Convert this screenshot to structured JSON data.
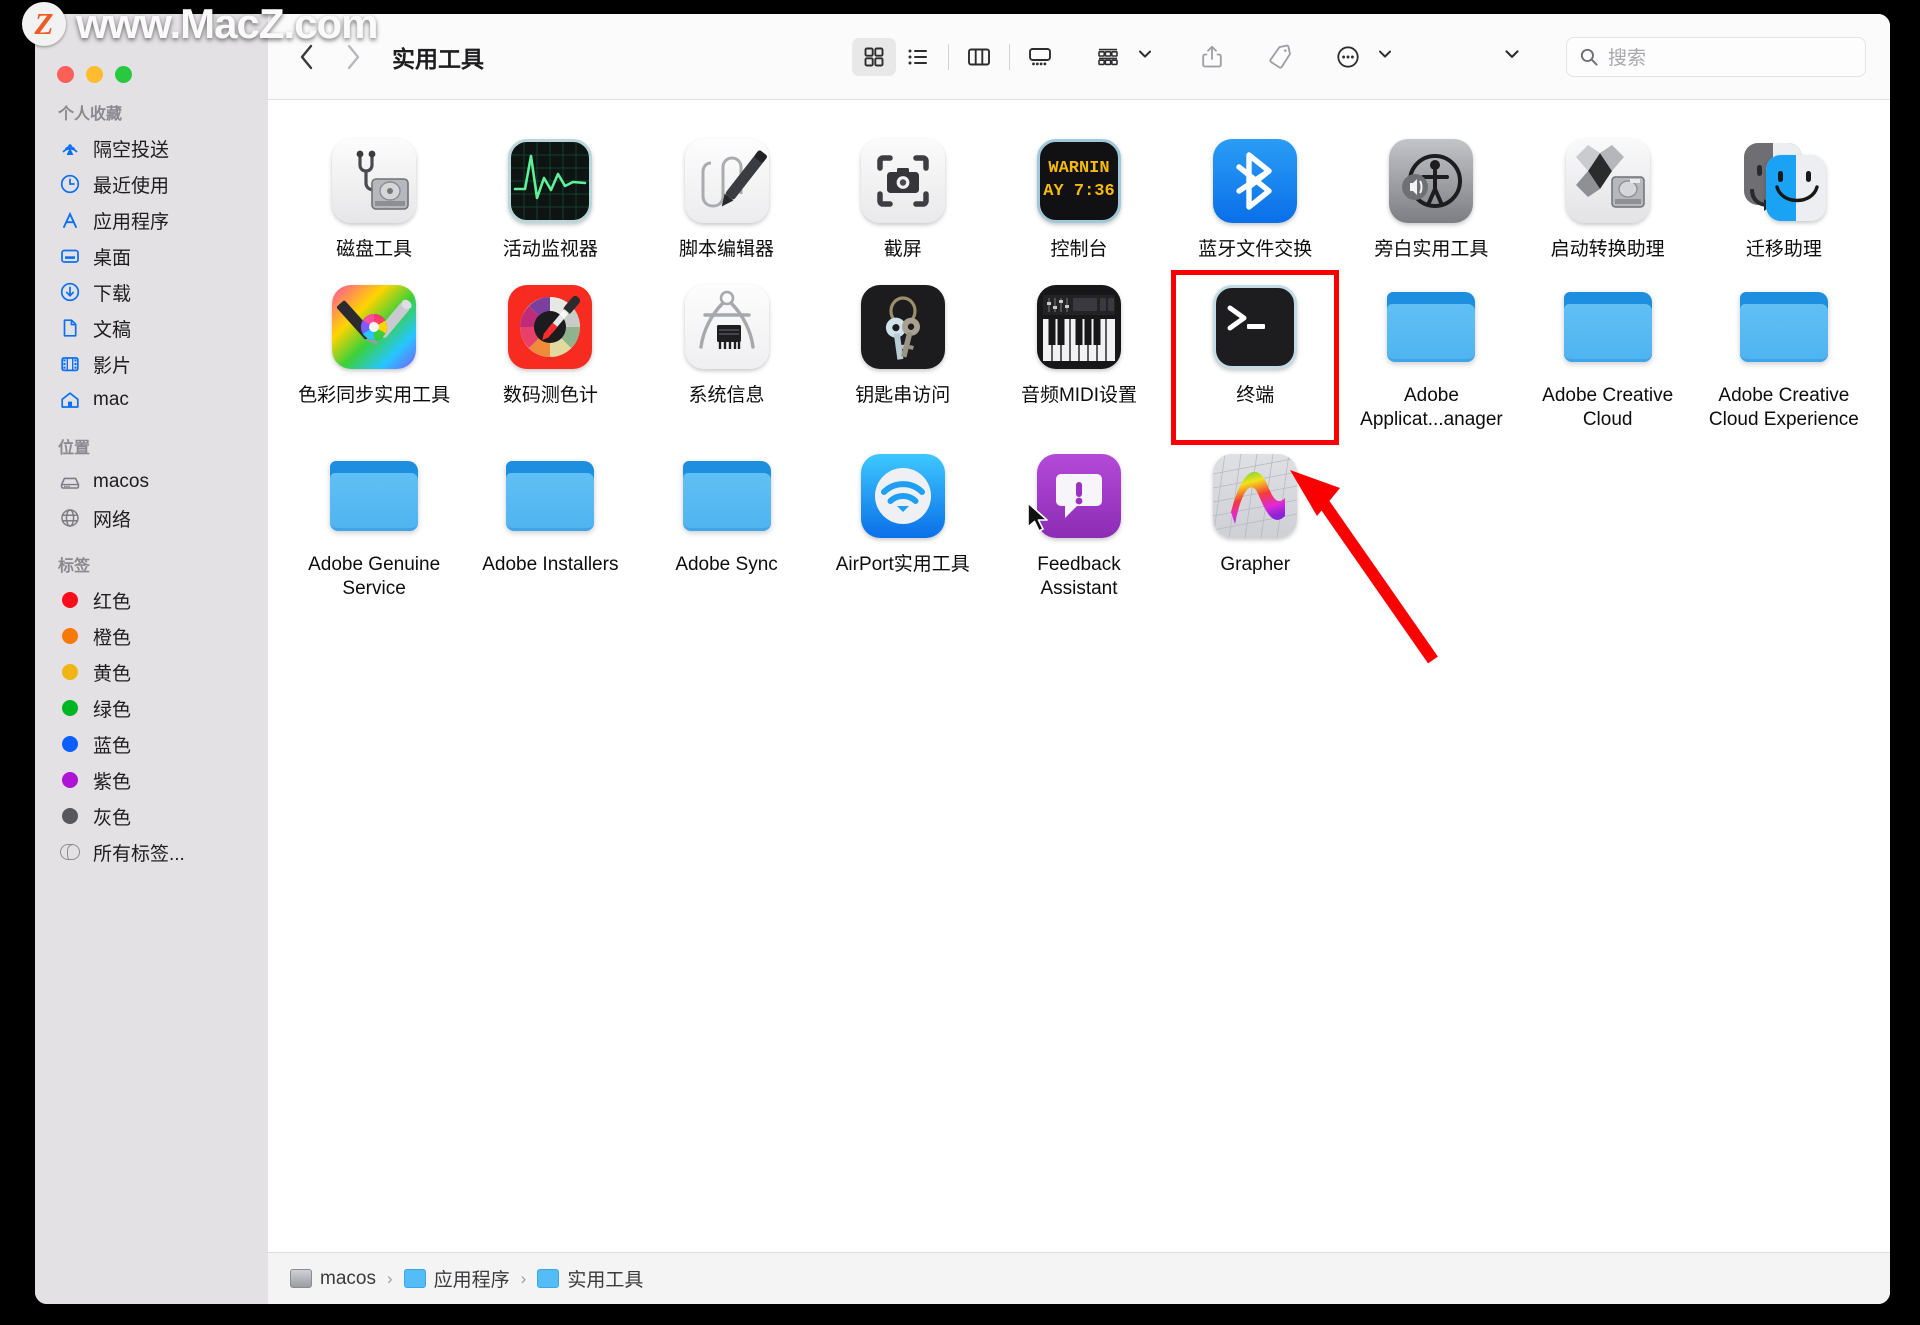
{
  "watermark": {
    "badge": "Z",
    "text": "www.MacZ.com"
  },
  "window": {
    "title": "实用工具",
    "traffic_lights": {
      "close": "close-red",
      "minimize": "minimize-yellow",
      "zoom": "zoom-green"
    }
  },
  "toolbar": {
    "back_label": "‹",
    "forward_label": "›",
    "view_icon_grid": "icon-view",
    "view_list": "list-view",
    "view_column": "column-view",
    "view_gallery": "gallery-view",
    "group_label": "group-by",
    "share_label": "share",
    "tag_label": "tag",
    "more_label": "more-actions"
  },
  "search": {
    "placeholder": "搜索",
    "value": ""
  },
  "sidebar": {
    "sections": [
      {
        "title": "个人收藏",
        "items": [
          {
            "label": "隔空投送",
            "icon": "airdrop-icon"
          },
          {
            "label": "最近使用",
            "icon": "clock-icon"
          },
          {
            "label": "应用程序",
            "icon": "applications-icon"
          },
          {
            "label": "桌面",
            "icon": "desktop-icon"
          },
          {
            "label": "下载",
            "icon": "downloads-icon"
          },
          {
            "label": "文稿",
            "icon": "documents-icon"
          },
          {
            "label": "影片",
            "icon": "movies-icon"
          },
          {
            "label": "mac",
            "icon": "home-icon"
          }
        ]
      },
      {
        "title": "位置",
        "items": [
          {
            "label": "macos",
            "icon": "harddisk-icon"
          },
          {
            "label": "网络",
            "icon": "network-globe-icon"
          }
        ]
      },
      {
        "title": "标签",
        "items": [
          {
            "label": "红色",
            "icon": "tag-dot-icon",
            "color": "#fc0d1b"
          },
          {
            "label": "橙色",
            "icon": "tag-dot-icon",
            "color": "#f77a09"
          },
          {
            "label": "黄色",
            "icon": "tag-dot-icon",
            "color": "#f0b513"
          },
          {
            "label": "绿色",
            "icon": "tag-dot-icon",
            "color": "#00b524"
          },
          {
            "label": "蓝色",
            "icon": "tag-dot-icon",
            "color": "#0b5fff"
          },
          {
            "label": "紫色",
            "icon": "tag-dot-icon",
            "color": "#ad14d6"
          },
          {
            "label": "灰色",
            "icon": "tag-dot-icon",
            "color": "#58585c"
          },
          {
            "label": "所有标签...",
            "icon": "all-tags-icon",
            "color": ""
          }
        ]
      }
    ]
  },
  "files": [
    {
      "name": "磁盘工具",
      "icon": "disk-utility-icon",
      "kind": "app"
    },
    {
      "name": "活动监视器",
      "icon": "activity-monitor-icon",
      "kind": "app"
    },
    {
      "name": "脚本编辑器",
      "icon": "script-editor-icon",
      "kind": "app"
    },
    {
      "name": "截屏",
      "icon": "screenshot-icon",
      "kind": "app"
    },
    {
      "name": "控制台",
      "icon": "console-icon",
      "kind": "app"
    },
    {
      "name": "蓝牙文件交换",
      "icon": "bluetooth-icon",
      "kind": "app"
    },
    {
      "name": "旁白实用工具",
      "icon": "voiceover-utility-icon",
      "kind": "app"
    },
    {
      "name": "启动转换助理",
      "icon": "boot-camp-assistant-icon",
      "kind": "app"
    },
    {
      "name": "迁移助理",
      "icon": "migration-assistant-icon",
      "kind": "app"
    },
    {
      "name": "色彩同步实用工具",
      "icon": "colorsync-utility-icon",
      "kind": "app"
    },
    {
      "name": "数码测色计",
      "icon": "digital-color-meter-icon",
      "kind": "app"
    },
    {
      "name": "系统信息",
      "icon": "system-information-icon",
      "kind": "app"
    },
    {
      "name": "钥匙串访问",
      "icon": "keychain-access-icon",
      "kind": "app"
    },
    {
      "name": "音频MIDI设置",
      "icon": "audio-midi-setup-icon",
      "kind": "app"
    },
    {
      "name": "终端",
      "icon": "terminal-icon",
      "kind": "app",
      "highlighted": true
    },
    {
      "name": "Adobe Applicat...anager",
      "icon": "folder-icon",
      "kind": "folder"
    },
    {
      "name": "Adobe Creative Cloud",
      "icon": "folder-icon",
      "kind": "folder"
    },
    {
      "name": "Adobe Creative Cloud Experience",
      "icon": "folder-icon",
      "kind": "folder"
    },
    {
      "name": "Adobe Genuine Service",
      "icon": "folder-icon",
      "kind": "folder"
    },
    {
      "name": "Adobe Installers",
      "icon": "folder-icon",
      "kind": "folder"
    },
    {
      "name": "Adobe Sync",
      "icon": "folder-icon",
      "kind": "folder"
    },
    {
      "name": "AirPort实用工具",
      "icon": "airport-utility-icon",
      "kind": "app"
    },
    {
      "name": "Feedback Assistant",
      "icon": "feedback-assistant-icon",
      "kind": "app"
    },
    {
      "name": "Grapher",
      "icon": "grapher-icon",
      "kind": "app"
    }
  ],
  "console_icon_text": {
    "line1": "WARNIN",
    "line2": "AY 7:36"
  },
  "pathbar": {
    "crumbs": [
      {
        "label": "macos",
        "icon": "harddisk-small-icon"
      },
      {
        "label": "应用程序",
        "icon": "folder-app-small-icon"
      },
      {
        "label": "实用工具",
        "icon": "folder-utilities-small-icon"
      }
    ],
    "separator": "›"
  },
  "annotation": {
    "highlight_color": "#fa0000",
    "arrow_color": "#fa0000",
    "target": "终端"
  }
}
